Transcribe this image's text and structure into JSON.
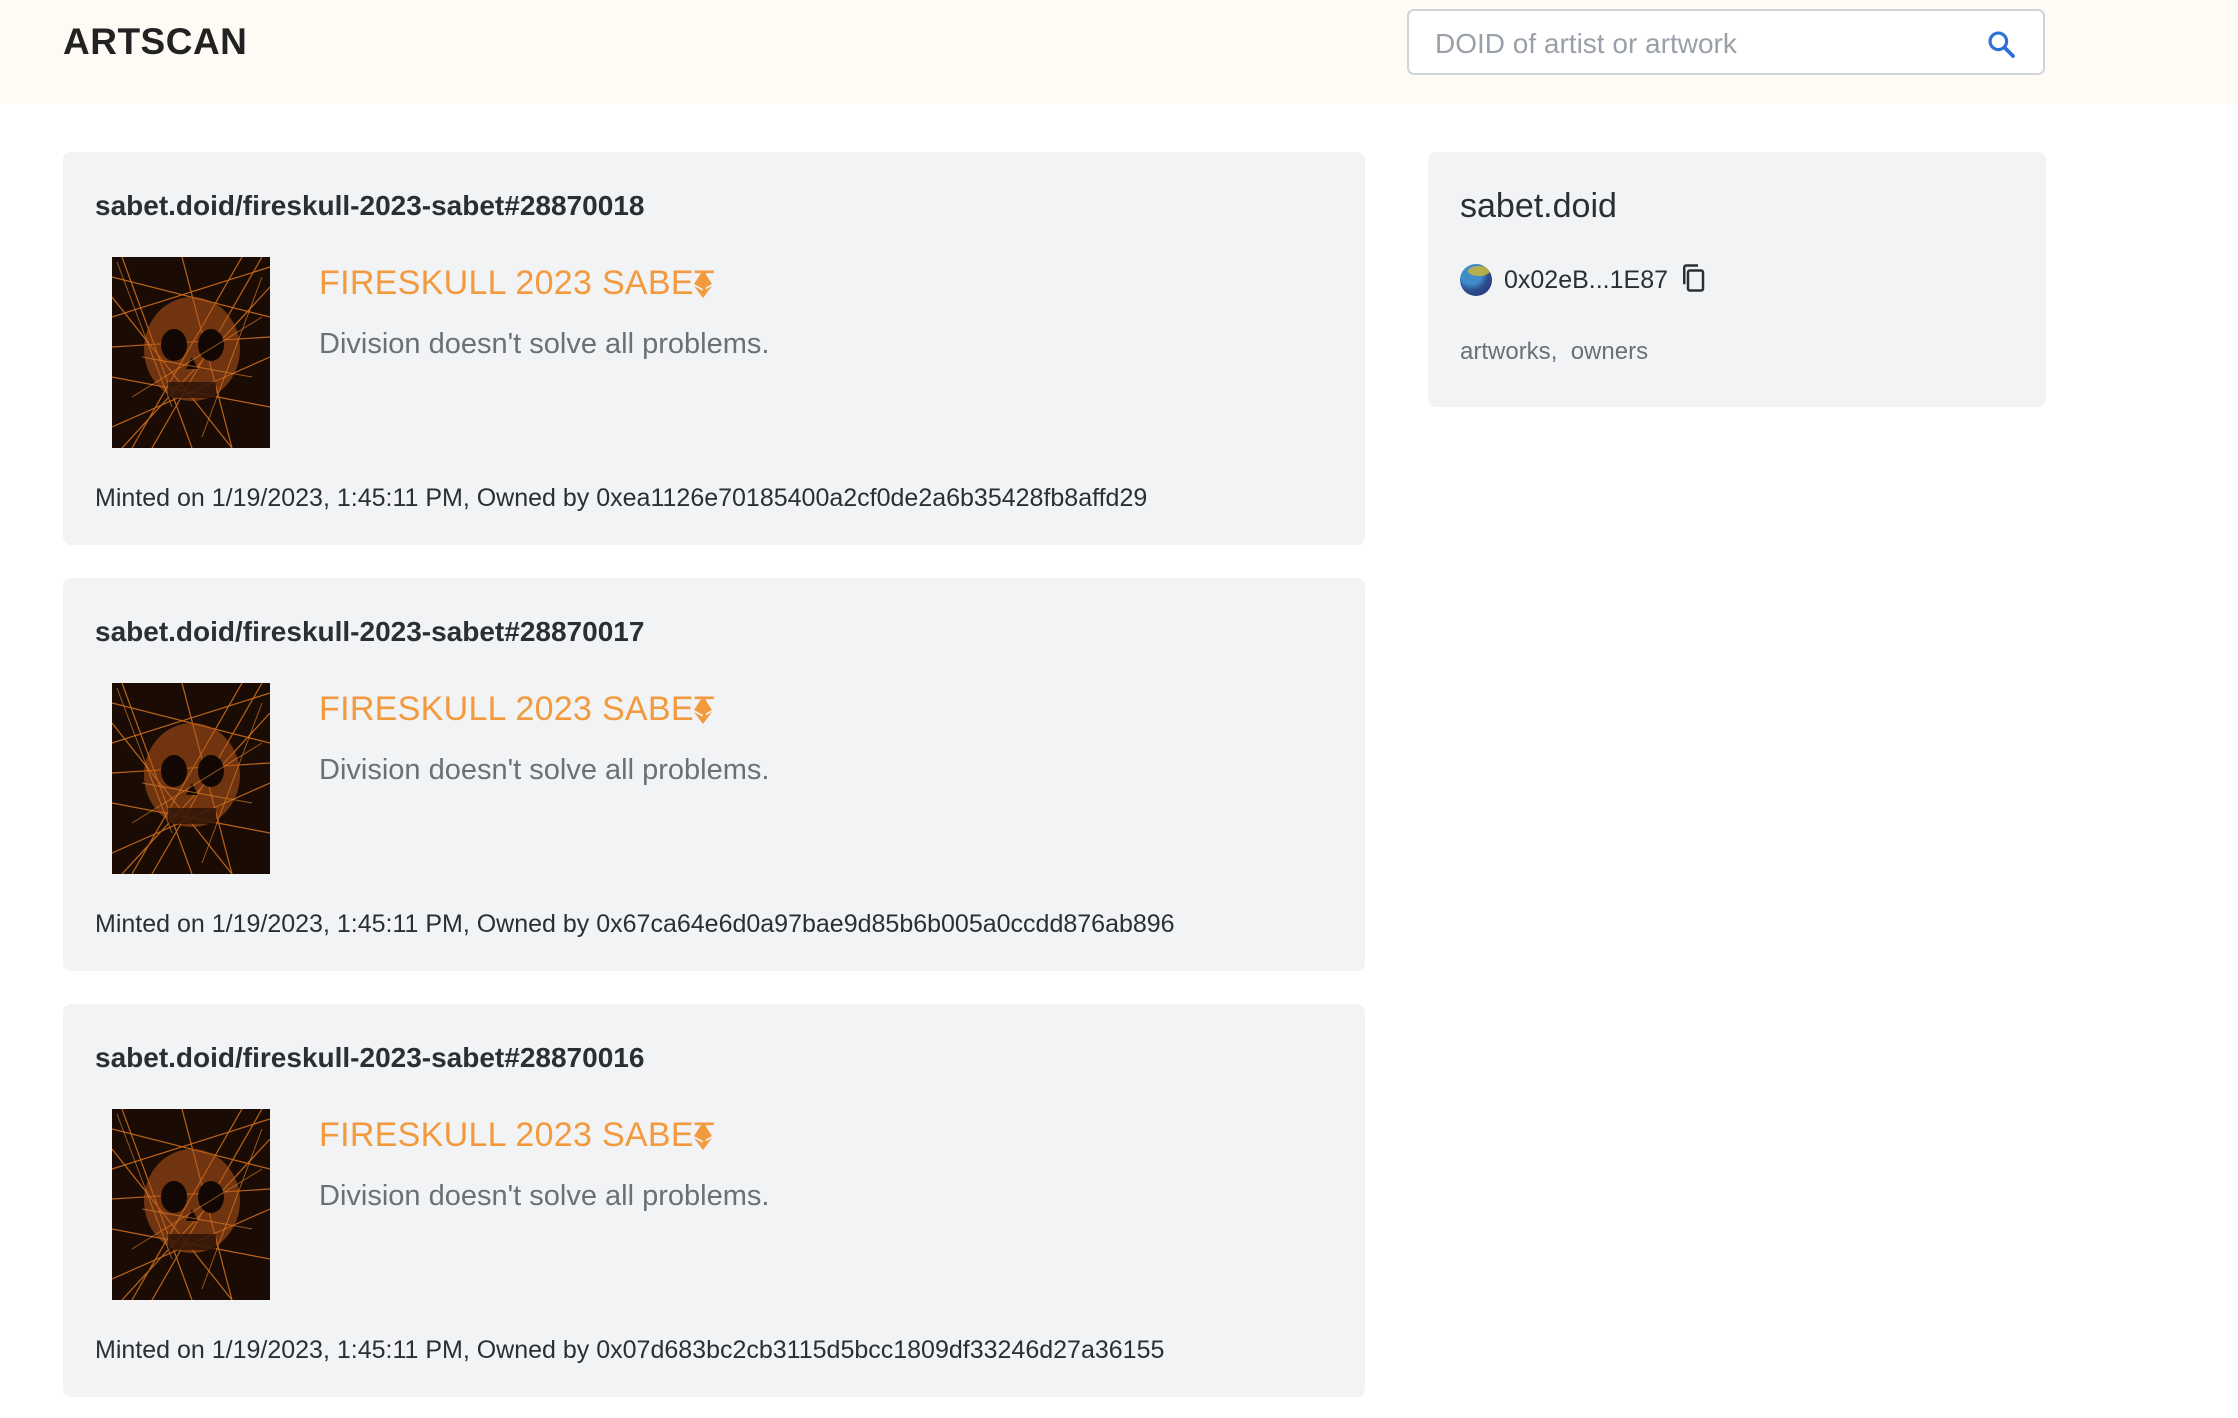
{
  "header": {
    "logo": "ARTSCAN",
    "search": {
      "placeholder": "DOID of artist or artwork",
      "value": ""
    }
  },
  "artworks": [
    {
      "id": "sabet.doid/fireskull-2023-sabet#28870018",
      "title": "FIRESKULL 2023 SABET",
      "description": "Division doesn't solve all problems.",
      "minted": "Minted on 1/19/2023, 1:45:11 PM, Owned by 0xea1126e70185400a2cf0de2a6b35428fb8affd29"
    },
    {
      "id": "sabet.doid/fireskull-2023-sabet#28870017",
      "title": "FIRESKULL 2023 SABET",
      "description": "Division doesn't solve all problems.",
      "minted": "Minted on 1/19/2023, 1:45:11 PM, Owned by 0x67ca64e6d0a97bae9d85b6b005a0ccdd876ab896"
    },
    {
      "id": "sabet.doid/fireskull-2023-sabet#28870016",
      "title": "FIRESKULL 2023 SABET",
      "description": "Division doesn't solve all problems.",
      "minted": "Minted on 1/19/2023, 1:45:11 PM, Owned by 0x07d683bc2cb3115d5bcc1809df33246d27a36155"
    }
  ],
  "profile": {
    "name": "sabet.doid",
    "address": "0x02eB...1E87",
    "links": [
      "artworks",
      "owners"
    ],
    "link_separator": ","
  },
  "colors": {
    "accent": "#f39a3e",
    "card_bg": "#f2f3f5",
    "header_bg": "#fefaf4",
    "search_icon": "#2f6fd6"
  },
  "icons": {
    "search": "search-icon",
    "chain": "ethereum-icon",
    "copy": "copy-icon"
  }
}
